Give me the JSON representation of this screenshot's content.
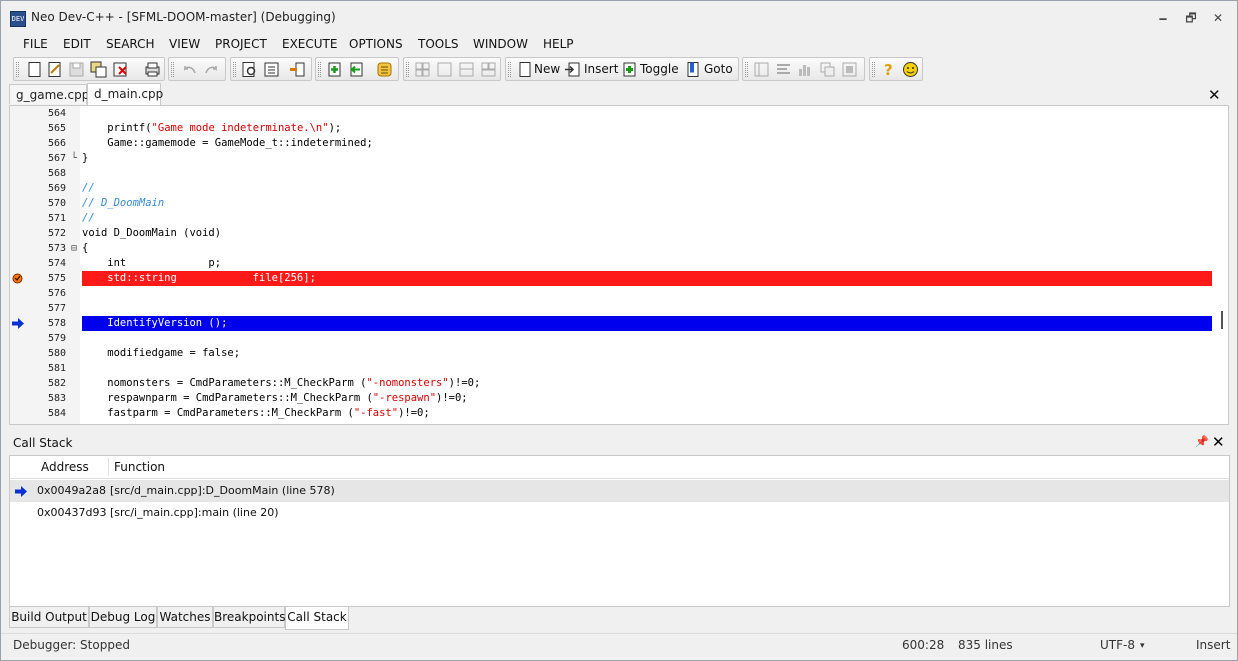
{
  "window": {
    "title": "Neo Dev-C++ - [SFML-DOOM-master] (Debugging)",
    "icon_text": "DEV",
    "controls": {
      "minimize": "🗕",
      "maximize": "🗗",
      "close": "✕"
    }
  },
  "menu": [
    "FILE",
    "EDIT",
    "SEARCH",
    "VIEW",
    "PROJECT",
    "EXECUTE",
    "OPTIONS",
    "TOOLS",
    "WINDOW",
    "HELP"
  ],
  "toolbar": {
    "new_label": "New",
    "insert_label": "Insert",
    "toggle_label": "Toggle",
    "goto_label": "Goto"
  },
  "editor_tabs": [
    {
      "label": "g_game.cpp",
      "active": false
    },
    {
      "label": "d_main.cpp",
      "active": true
    }
  ],
  "editor_close": "✕",
  "code_lines": [
    {
      "num": "564",
      "fold": "",
      "text": "",
      "marker": ""
    },
    {
      "num": "565",
      "fold": "",
      "pre": "    printf(",
      "str": "\"Game mode indeterminate.\\n\"",
      "post": ");",
      "marker": ""
    },
    {
      "num": "566",
      "fold": "",
      "text": "    Game::gamemode = GameMode_t::indetermined;",
      "marker": ""
    },
    {
      "num": "567",
      "fold": "└",
      "text": "}",
      "marker": ""
    },
    {
      "num": "568",
      "fold": "",
      "text": "",
      "marker": ""
    },
    {
      "num": "569",
      "fold": "",
      "cmt": "//",
      "marker": ""
    },
    {
      "num": "570",
      "fold": "",
      "cmt": "// D_DoomMain",
      "marker": ""
    },
    {
      "num": "571",
      "fold": "",
      "cmt": "//",
      "marker": ""
    },
    {
      "num": "572",
      "fold": "",
      "text": "void D_DoomMain (void)",
      "marker": ""
    },
    {
      "num": "573",
      "fold": "⊟",
      "text": "{",
      "marker": ""
    },
    {
      "num": "574",
      "fold": "",
      "text": "    int             p;",
      "marker": ""
    },
    {
      "num": "575",
      "fold": "",
      "text": "    std::string            file[256];",
      "marker": "breakpoint"
    },
    {
      "num": "576",
      "fold": "",
      "text": "",
      "marker": ""
    },
    {
      "num": "577",
      "fold": "",
      "text": "",
      "marker": ""
    },
    {
      "num": "578",
      "fold": "",
      "text": "    IdentifyVersion ();",
      "marker": "exec"
    },
    {
      "num": "579",
      "fold": "",
      "text": "",
      "marker": ""
    },
    {
      "num": "580",
      "fold": "",
      "text": "    modifiedgame = false;",
      "marker": ""
    },
    {
      "num": "581",
      "fold": "",
      "text": "",
      "marker": ""
    },
    {
      "num": "582",
      "fold": "",
      "pre": "    nomonsters = CmdParameters::M_CheckParm (",
      "str": "\"-nomonsters\"",
      "post": ")!=0;",
      "marker": ""
    },
    {
      "num": "583",
      "fold": "",
      "pre": "    respawnparm = CmdParameters::M_CheckParm (",
      "str": "\"-respawn\"",
      "post": ")!=0;",
      "marker": ""
    },
    {
      "num": "584",
      "fold": "",
      "pre": "    fastparm = CmdParameters::M_CheckParm (",
      "str": "\"-fast\"",
      "post": ")!=0;",
      "marker": ""
    }
  ],
  "call_stack": {
    "title": "Call Stack",
    "pin": "📌",
    "close": "✕",
    "columns": [
      "Address",
      "Function"
    ],
    "rows": [
      {
        "address": "0x0049a2a8",
        "function": "[src/d_main.cpp]:D_DoomMain (line 578)",
        "current": true
      },
      {
        "address": "0x00437d93",
        "function": "[src/i_main.cpp]:main (line 20)",
        "current": false
      }
    ]
  },
  "bottom_tabs": [
    {
      "label": "Build Output",
      "active": false
    },
    {
      "label": "Debug Log",
      "active": false
    },
    {
      "label": "Watches",
      "active": false
    },
    {
      "label": "Breakpoints",
      "active": false
    },
    {
      "label": "Call Stack",
      "active": true
    }
  ],
  "status": {
    "debugger": "Debugger: Stopped",
    "position": "600:28",
    "lines": "835 lines",
    "encoding": "UTF-8",
    "encoding_arrow": "▾",
    "mode": "Insert"
  },
  "colors": {
    "breakpoint_line": "#ff1a1a",
    "exec_line": "#0000ee",
    "string": "#d40000",
    "comment": "#3a8cd6"
  }
}
